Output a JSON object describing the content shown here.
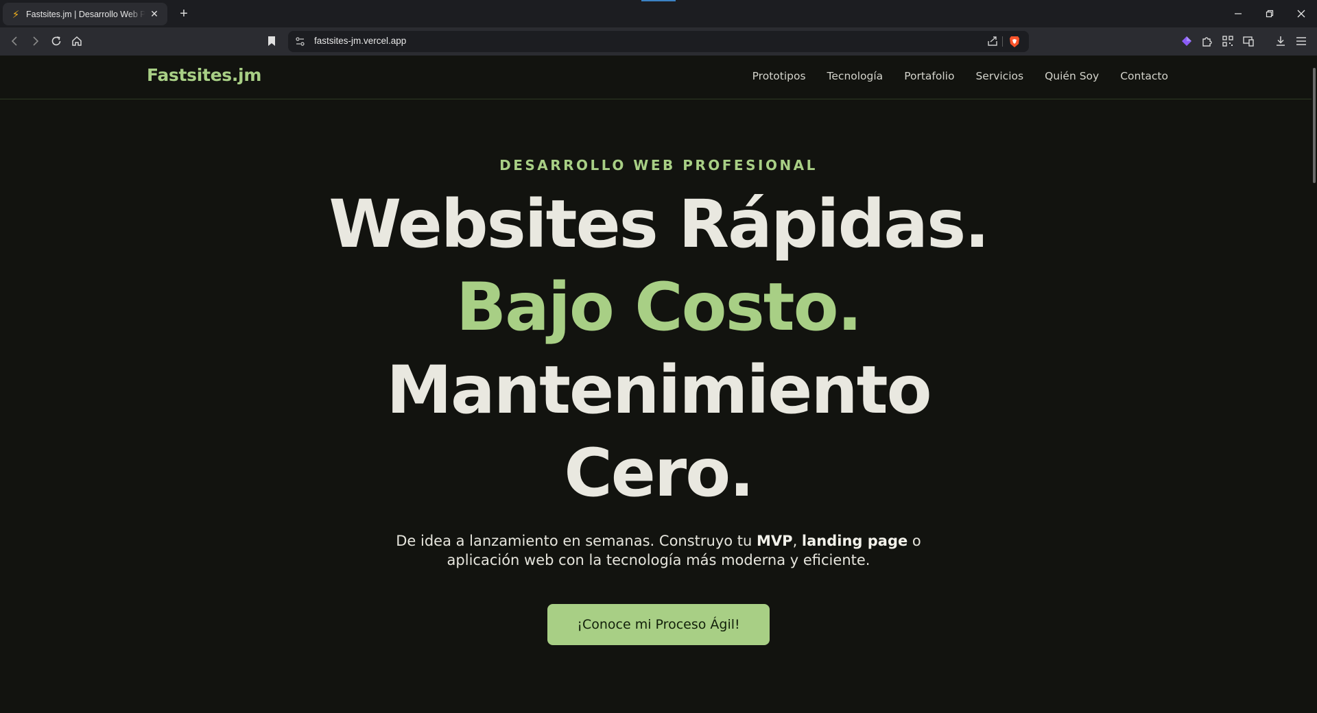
{
  "browser": {
    "tab_title": "Fastsites.jm | Desarrollo Web Profesional",
    "tab_favicon": "lightning-icon",
    "url": "fastsites-jm.vercel.app",
    "new_tab_label": "+"
  },
  "site": {
    "logo": "Fastsites.jm",
    "nav": [
      "Prototipos",
      "Tecnología",
      "Portafolio",
      "Servicios",
      "Quién Soy",
      "Contacto"
    ]
  },
  "hero": {
    "kicker": "DESARROLLO WEB PROFESIONAL",
    "line1": "Websites Rápidas.",
    "line2": "Bajo Costo.",
    "line3": "Mantenimiento",
    "line4": "Cero.",
    "subtitle_a": "De idea a lanzamiento en semanas. Construyo tu ",
    "subtitle_b": "MVP",
    "subtitle_c": ", ",
    "subtitle_d": "landing page",
    "subtitle_e": " o aplicación web con la tecnología más moderna y eficiente.",
    "cta": "¡Conoce mi Proceso Ágil!"
  },
  "colors": {
    "accent": "#a8cf85",
    "background": "#12130f",
    "text": "#e9e8e0"
  }
}
